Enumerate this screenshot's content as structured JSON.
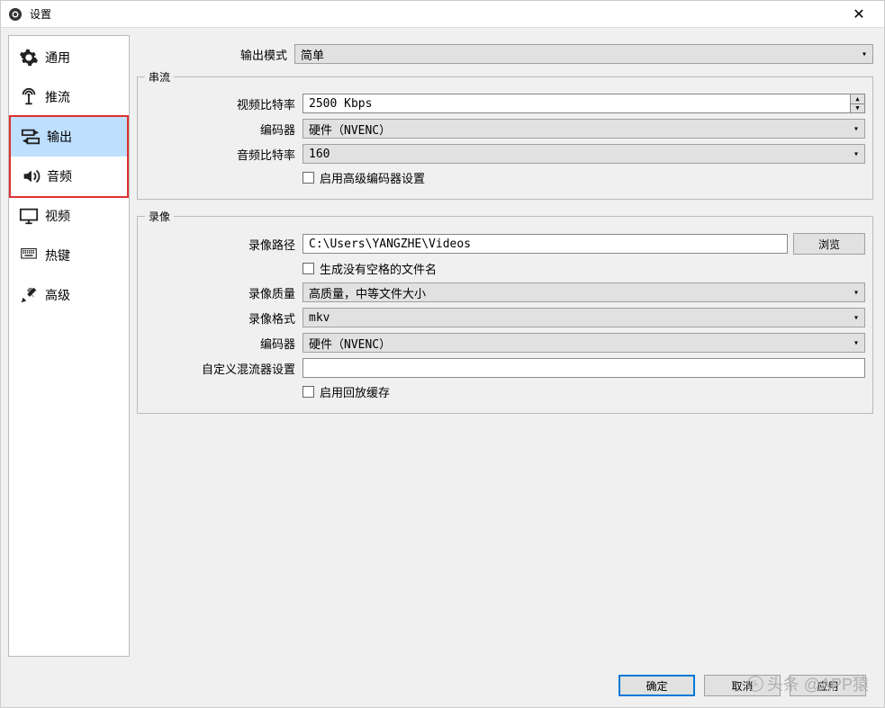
{
  "window": {
    "title": "设置",
    "close": "✕"
  },
  "sidebar": {
    "items": [
      {
        "label": "通用"
      },
      {
        "label": "推流"
      },
      {
        "label": "输出"
      },
      {
        "label": "音频"
      },
      {
        "label": "视频"
      },
      {
        "label": "热键"
      },
      {
        "label": "高级"
      }
    ]
  },
  "output_mode": {
    "label": "输出模式",
    "value": "简单"
  },
  "stream": {
    "legend": "串流",
    "video_bitrate": {
      "label": "视频比特率",
      "value": "2500 Kbps"
    },
    "encoder": {
      "label": "编码器",
      "value": "硬件（NVENC）"
    },
    "audio_bitrate": {
      "label": "音频比特率",
      "value": "160"
    },
    "adv_checkbox": {
      "label": "启用高级编码器设置"
    }
  },
  "record": {
    "legend": "录像",
    "path": {
      "label": "录像路径",
      "value": "C:\\Users\\YANGZHE\\Videos"
    },
    "browse": "浏览",
    "nospace_checkbox": {
      "label": "生成没有空格的文件名"
    },
    "quality": {
      "label": "录像质量",
      "value": "高质量，中等文件大小"
    },
    "format": {
      "label": "录像格式",
      "value": "mkv"
    },
    "encoder": {
      "label": "编码器",
      "value": "硬件（NVENC）"
    },
    "muxer": {
      "label": "自定义混流器设置",
      "value": ""
    },
    "replay_checkbox": {
      "label": "启用回放缓存"
    }
  },
  "buttons": {
    "ok": "确定",
    "cancel": "取消",
    "apply": "应用"
  },
  "watermark": "头条 @APP猿"
}
